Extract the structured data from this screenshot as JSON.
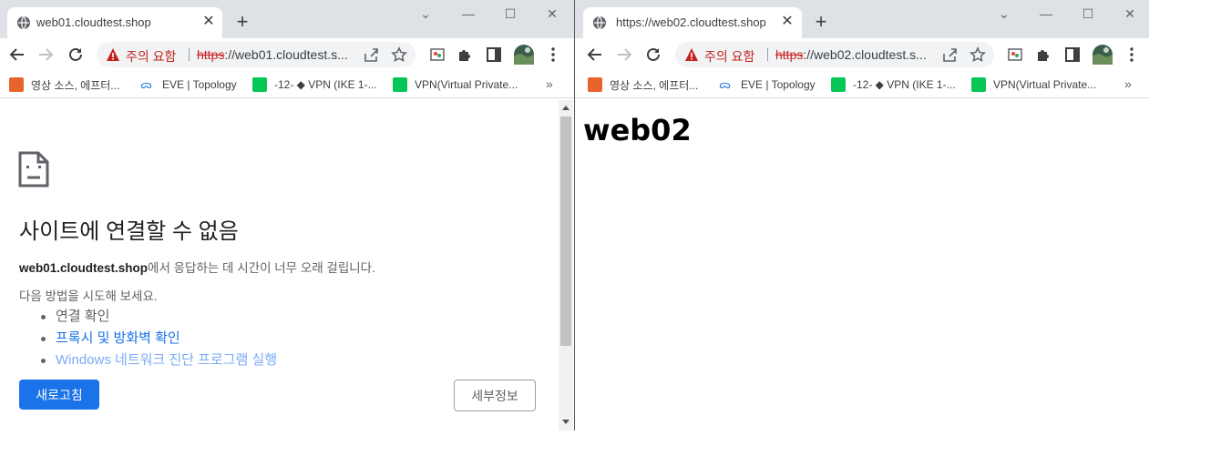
{
  "window1": {
    "tab_title": "web01.cloudtest.shop",
    "warning_label": "주의 요함",
    "url_scheme": "https",
    "url_rest": "://web01.cloudtest.s...",
    "bookmarks": [
      "영상 소스, 에프터...",
      "EVE | Topology",
      "-12- ◆ VPN (IKE 1-...",
      "VPN(Virtual Private..."
    ],
    "error": {
      "heading": "사이트에 연결할 수 없음",
      "host": "web01.cloudtest.shop",
      "message": "에서 응답하는 데 시간이 너무 오래 걸립니다.",
      "try_label": "다음 방법을 시도해 보세요.",
      "suggestions": [
        "연결 확인",
        "프록시 및 방화벽 확인",
        "Windows 네트워크 진단 프로그램 실행"
      ],
      "reload_label": "새로고침",
      "details_label": "세부정보"
    }
  },
  "window2": {
    "tab_title": "https://web02.cloudtest.shop",
    "warning_label": "주의 요함",
    "url_scheme": "https",
    "url_rest": "://web02.cloudtest.s...",
    "bookmarks": [
      "영상 소스, 에프터...",
      "EVE | Topology",
      "-12- ◆ VPN (IKE 1-...",
      "VPN(Virtual Private..."
    ],
    "page_heading": "web02"
  },
  "colors": {
    "accent": "#1a73e8",
    "warning": "#c5221f",
    "tabstrip": "#dee1e6"
  }
}
